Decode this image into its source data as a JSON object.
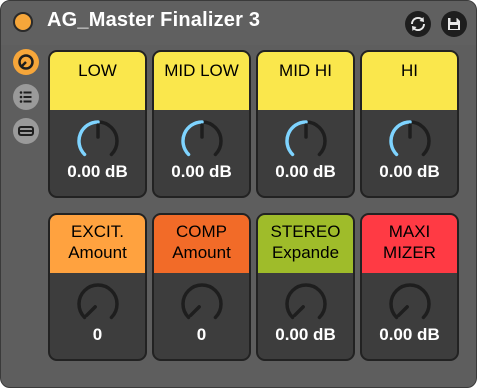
{
  "device": {
    "title": "AG_Master Finalizer 3",
    "colors": {
      "panel_bg": "#5e5e5e",
      "power": "#f6a63a",
      "knob_arc": "#7fd4ff"
    }
  },
  "header_buttons": [
    {
      "name": "swap-icon"
    },
    {
      "name": "save-icon"
    }
  ],
  "sidebar": [
    {
      "name": "device-active-icon",
      "color": "#f6a63a"
    },
    {
      "name": "list-icon",
      "color": "#9a9a9a"
    },
    {
      "name": "minus-icon",
      "color": "#9a9a9a"
    }
  ],
  "panels": [
    {
      "id": "low",
      "lines": [
        "LOW"
      ],
      "value": "0.00 dB",
      "color": "#fae74c",
      "level": 0.5,
      "arc": true
    },
    {
      "id": "mid-low",
      "lines": [
        "MID LOW"
      ],
      "value": "0.00 dB",
      "color": "#fae74c",
      "level": 0.5,
      "arc": true
    },
    {
      "id": "mid-hi",
      "lines": [
        "MID  HI"
      ],
      "value": "0.00 dB",
      "color": "#fae74c",
      "level": 0.5,
      "arc": true
    },
    {
      "id": "hi",
      "lines": [
        "HI"
      ],
      "value": "0.00 dB",
      "color": "#fae74c",
      "level": 0.5,
      "arc": true
    },
    {
      "id": "excit-amount",
      "lines": [
        "EXCIT.",
        "Amount"
      ],
      "value": "0",
      "color": "#ffa23f",
      "level": 0.0,
      "arc": false
    },
    {
      "id": "comp-amount",
      "lines": [
        "COMP",
        "Amount"
      ],
      "value": "0",
      "color": "#f26b28",
      "level": 0.0,
      "arc": false
    },
    {
      "id": "stereo-expande",
      "lines": [
        "STEREO",
        "Expande"
      ],
      "value": "0.00 dB",
      "color": "#9fbc2a",
      "level": 0.0,
      "arc": false
    },
    {
      "id": "maxi-mizer",
      "lines": [
        "MAXI",
        "MIZER"
      ],
      "value": "0.00 dB",
      "color": "#ff3a44",
      "level": 0.0,
      "arc": false
    }
  ]
}
